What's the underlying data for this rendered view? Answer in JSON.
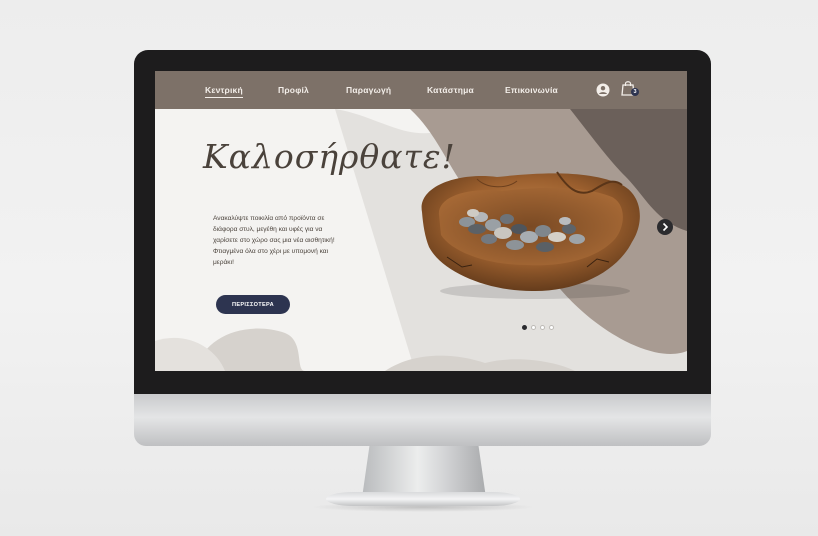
{
  "nav": {
    "items": [
      {
        "label": "Κεντρική",
        "active": true
      },
      {
        "label": "Προφίλ",
        "active": false
      },
      {
        "label": "Παραγωγή",
        "active": false
      },
      {
        "label": "Κατάστημα",
        "active": false
      },
      {
        "label": "Επικοινωνία",
        "active": false
      }
    ],
    "account_icon": "user-circle-icon",
    "cart_icon": "shopping-bag-icon",
    "cart_count": "3"
  },
  "hero": {
    "title": "Καλοσήρθατε!",
    "text": "Ανακαλύψτε ποικιλία από προϊόντα σε διάφορα στυλ, μεγέθη και υφές για να χαρίσετε στο χώρο σας μια νέα αισθητική! Φτιαγμένα όλα στο χέρι με υπομονή και μεράκι!",
    "cta_label": "ΠΕΡΙΣΣΟΤΕΡΑ",
    "image": "wooden-bowl-with-stones",
    "next_icon": "chevron-right-icon"
  },
  "carousel": {
    "dots": 4,
    "active_index": 0
  },
  "colors": {
    "nav_bg": "#7d7168",
    "accent": "#2d3450",
    "shape_taupe": "#a89b92",
    "shape_dark": "#6b605a",
    "shape_light": "#d6d2cd"
  }
}
